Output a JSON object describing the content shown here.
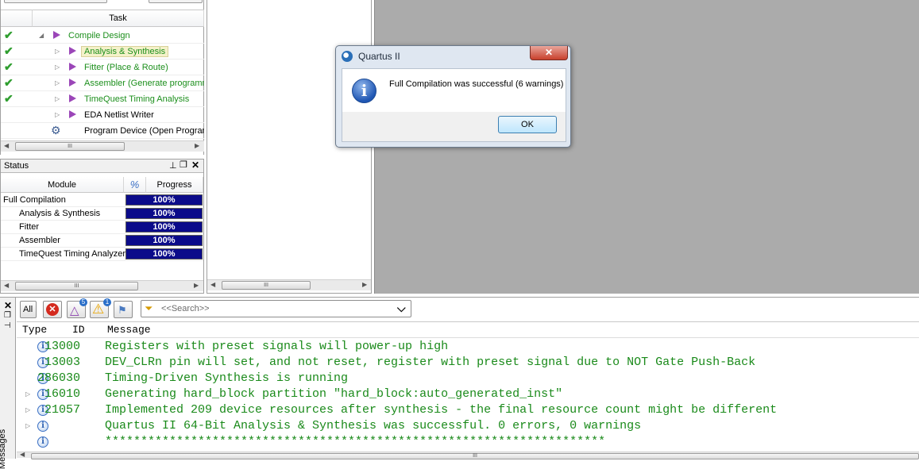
{
  "tasks": {
    "header": "Task",
    "items": [
      {
        "label": "Compile Design",
        "done": true,
        "expander": "◢"
      },
      {
        "label": "Analysis & Synthesis",
        "done": true,
        "expander": "▷"
      },
      {
        "label": "Fitter (Place & Route)",
        "done": true,
        "expander": "▷"
      },
      {
        "label": "Assembler (Generate programming",
        "done": true,
        "expander": "▷"
      },
      {
        "label": "TimeQuest Timing Analysis",
        "done": true,
        "expander": "▷"
      },
      {
        "label": "EDA Netlist Writer",
        "done": false,
        "expander": "▷"
      },
      {
        "label": "Program Device (Open Programmer)",
        "done": false,
        "expander": ""
      }
    ]
  },
  "status": {
    "title": "Status",
    "col_module": "Module",
    "col_percent": "%",
    "col_progress": "Progress",
    "rows": [
      {
        "module": "Full Compilation",
        "progress": "100%"
      },
      {
        "module": "Analysis & Synthesis",
        "progress": "100%"
      },
      {
        "module": "Fitter",
        "progress": "100%"
      },
      {
        "module": "Assembler",
        "progress": "100%"
      },
      {
        "module": "TimeQuest Timing Analyzer",
        "progress": "100%"
      }
    ]
  },
  "dialog": {
    "title": "Quartus II",
    "message": "Full Compilation was successful (6 warnings)",
    "ok_label": "OK"
  },
  "messages": {
    "side_label": "Messages",
    "toolbar": {
      "all_label": "All",
      "warning_badge": "5",
      "critical_badge": "1",
      "search_placeholder": "<<Search>>"
    },
    "columns": {
      "type": "Type",
      "id": "ID",
      "message": "Message"
    },
    "rows": [
      {
        "id": "13000",
        "text": "Registers with preset signals will power-up high",
        "expandable": false
      },
      {
        "id": "13003",
        "text": "DEV_CLRn pin will set, and not reset, register with preset signal due to NOT Gate Push-Back",
        "expandable": false
      },
      {
        "id": "286030",
        "text": "Timing-Driven Synthesis is running",
        "expandable": false
      },
      {
        "id": "16010",
        "text": "Generating hard_block partition \"hard_block:auto_generated_inst\"",
        "expandable": true
      },
      {
        "id": "21057",
        "text": "Implemented 209 device resources after synthesis - the final resource count might be different",
        "expandable": true
      },
      {
        "id": "",
        "text": "Quartus II 64-Bit Analysis & Synthesis was successful. 0 errors, 0 warnings",
        "expandable": true
      },
      {
        "id": "",
        "text": "**********************************************************************",
        "expandable": false
      }
    ]
  },
  "colors": {
    "task_green": "#1c8f1c",
    "progress_blue": "#0b0b8a",
    "message_green": "#1a8a1a"
  }
}
